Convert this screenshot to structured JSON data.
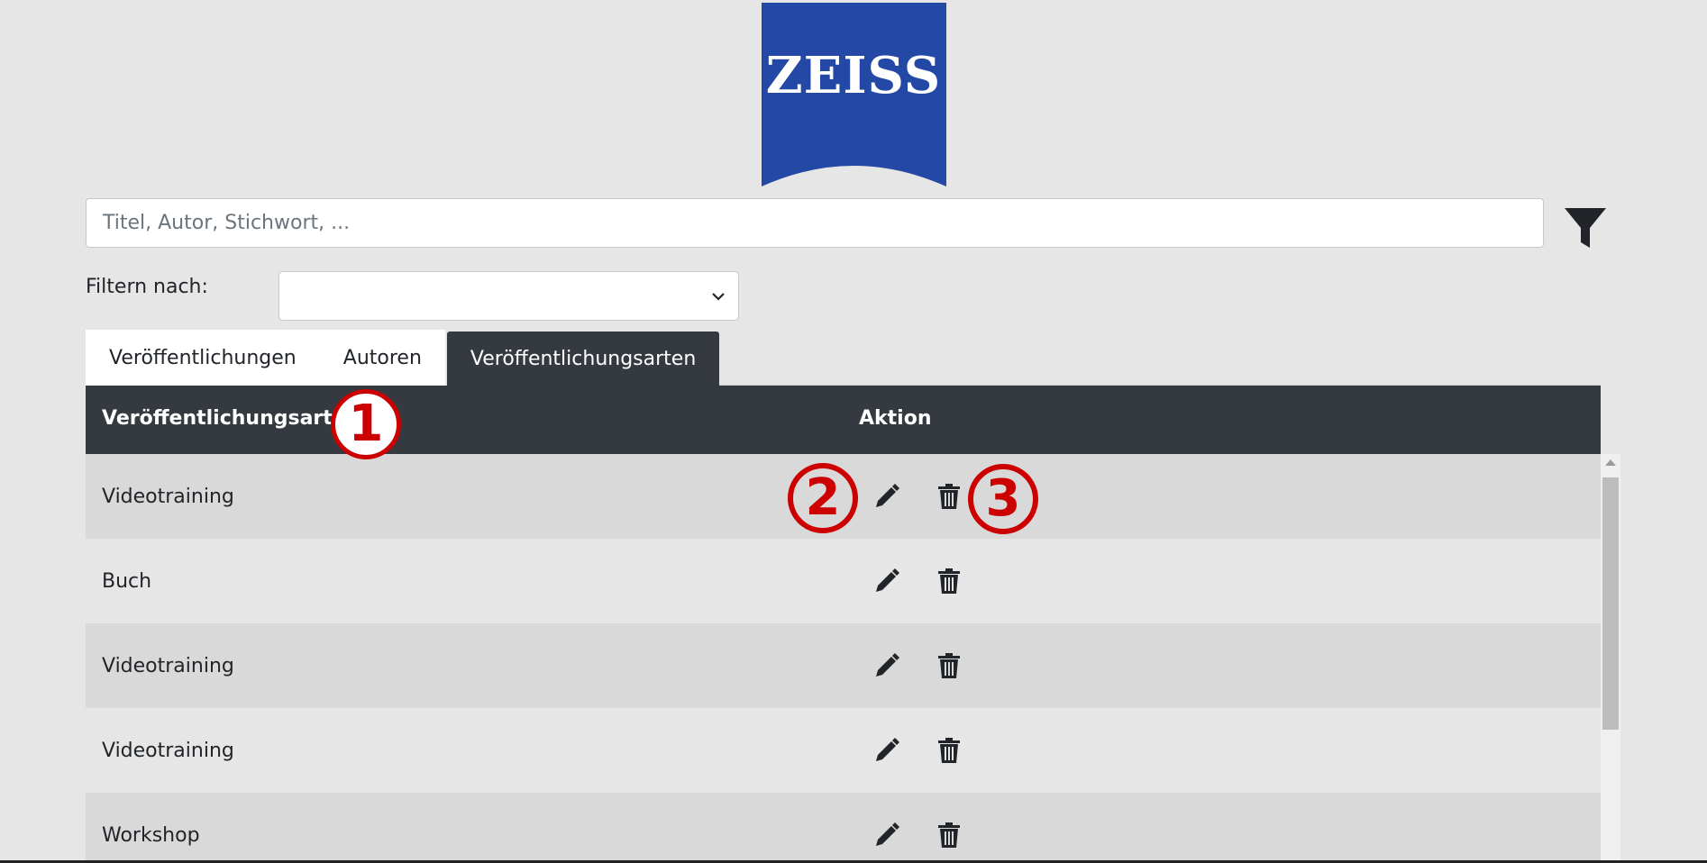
{
  "brand": {
    "logo_text": "ZEISS",
    "logo_color": "#2348a5"
  },
  "search": {
    "placeholder": "Titel, Autor, Stichwort, ..."
  },
  "filter": {
    "label": "Filtern nach:",
    "selected": ""
  },
  "tabs": [
    {
      "label": "Veröffentlichungen",
      "active": false
    },
    {
      "label": "Autoren",
      "active": false
    },
    {
      "label": "Veröffentlichungsarten",
      "active": true
    }
  ],
  "table": {
    "columns": [
      "Veröffentlichungsart",
      "Aktion"
    ],
    "rows": [
      {
        "name": "Videotraining"
      },
      {
        "name": "Buch"
      },
      {
        "name": "Videotraining"
      },
      {
        "name": "Videotraining"
      },
      {
        "name": "Workshop"
      }
    ]
  },
  "markers": [
    "1",
    "2",
    "3"
  ],
  "icons": {
    "filter": "filter-icon",
    "edit": "pencil-icon",
    "delete": "trash-icon",
    "select": "chevron-down-icon"
  },
  "colors": {
    "header_bg": "#343a40",
    "marker": "#cc0000",
    "row_odd": "#d9d9d9",
    "row_even": "#e6e6e6"
  }
}
